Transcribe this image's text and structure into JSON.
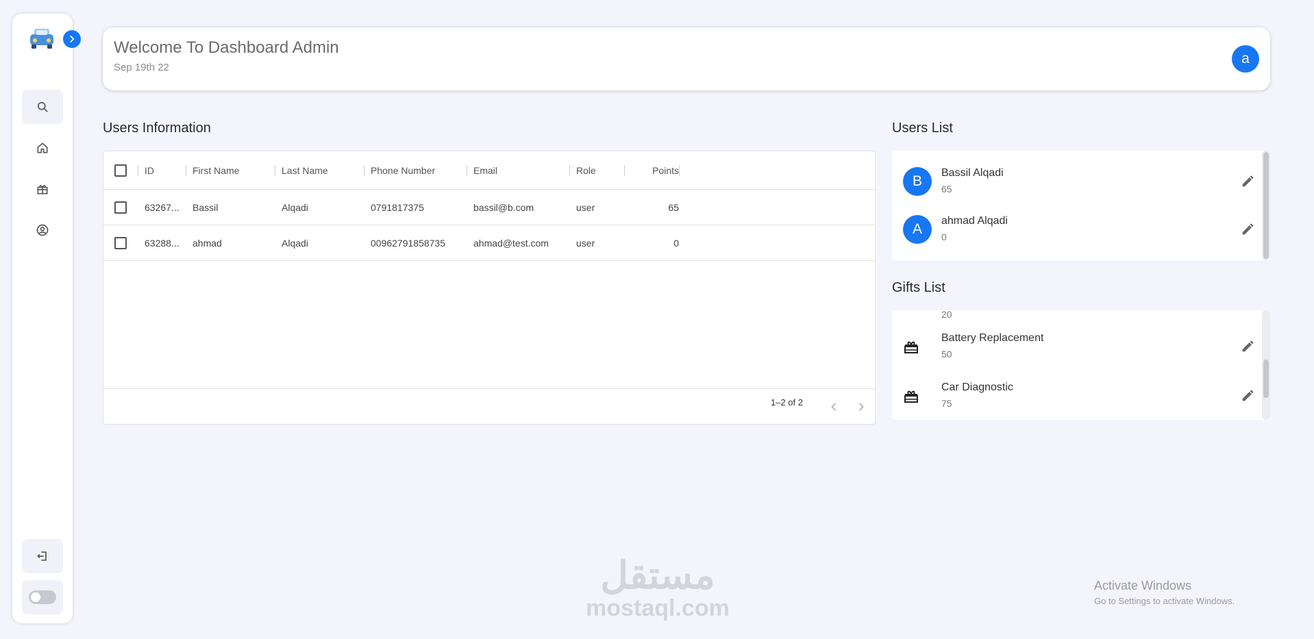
{
  "sidebar": {
    "nav": [
      {
        "icon": "search-icon",
        "active": true
      },
      {
        "icon": "home-icon",
        "active": false
      },
      {
        "icon": "gift-icon",
        "active": false
      },
      {
        "icon": "account-circle-icon",
        "active": false
      }
    ],
    "logout_icon": "logout-icon",
    "theme_toggle": "off"
  },
  "header": {
    "title": "Welcome To Dashboard Admin",
    "date": "Sep 19th 22",
    "avatar_letter": "a"
  },
  "users_information": {
    "title": "Users Information",
    "columns": [
      "ID",
      "First Name",
      "Last Name",
      "Phone Number",
      "Email",
      "Role",
      "Points"
    ],
    "rows": [
      {
        "id": "63267...",
        "first_name": "Bassil",
        "last_name": "Alqadi",
        "phone": "0791817375",
        "email": "bassil@b.com",
        "role": "user",
        "points": "65"
      },
      {
        "id": "63288...",
        "first_name": "ahmad",
        "last_name": "Alqadi",
        "phone": "00962791858735",
        "email": "ahmad@test.com",
        "role": "user",
        "points": "0"
      }
    ],
    "pagination": "1–2 of 2"
  },
  "users_list": {
    "title": "Users List",
    "items": [
      {
        "avatar": "B",
        "name": "Bassil Alqadi",
        "points": "65"
      },
      {
        "avatar": "A",
        "name": "ahmad Alqadi",
        "points": "0"
      }
    ]
  },
  "gifts_list": {
    "title": "Gifts List",
    "partial_top_value": "20",
    "items": [
      {
        "icon": "gift-icon",
        "name": "Battery Replacement",
        "points": "50"
      },
      {
        "icon": "gift-icon",
        "name": "Car Diagnostic",
        "points": "75"
      }
    ]
  },
  "watermarks": {
    "mostaql_arabic": "مستقل",
    "mostaql_latin": "mostaql.com",
    "activate_title": "Activate Windows",
    "activate_sub": "Go to Settings to activate Windows."
  },
  "colors": {
    "accent": "#1877f2",
    "background": "#f4f4fc"
  }
}
